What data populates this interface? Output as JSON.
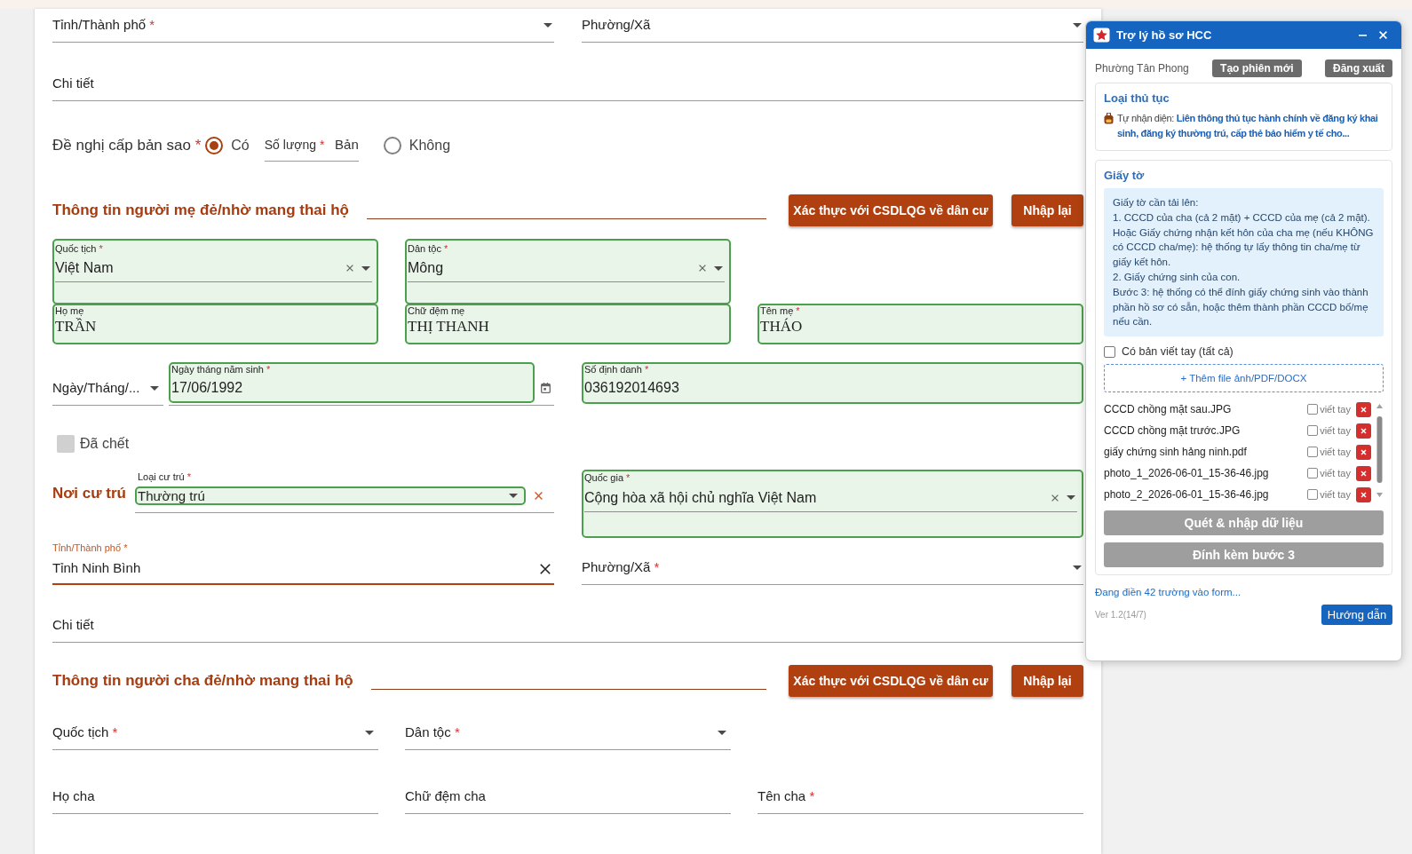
{
  "address_top": {
    "province": {
      "label": "Tỉnh/Thành phố",
      "required_mark": "*"
    },
    "ward": {
      "label": "Phường/Xã"
    },
    "detail": {
      "label": "Chi tiết"
    }
  },
  "copy_request": {
    "label": "Đề nghị cấp bản sao",
    "required_mark": "*",
    "options": [
      {
        "label": "Có",
        "selected": true
      },
      {
        "label": "Không",
        "selected": false
      }
    ],
    "quantity": {
      "label": "Số lượng",
      "required_mark": "*",
      "unit": "Bản"
    }
  },
  "mother": {
    "title": "Thông tin người mẹ đẻ/nhờ mang thai hộ",
    "buttons": [
      "Xác thực với CSDLQG về dân cư",
      "Nhập lại"
    ],
    "nationality": {
      "label": "Quốc tịch",
      "required_mark": "*",
      "value": "Việt Nam",
      "filled": true
    },
    "ethnicity": {
      "label": "Dân tộc",
      "required_mark": "*",
      "value": "Mông",
      "filled": true
    },
    "last_name": {
      "label": "Họ mẹ",
      "value": "TRẦN",
      "filled": true
    },
    "middle_name": {
      "label": "Chữ đệm mẹ",
      "value": "THỊ THANH",
      "filled": true
    },
    "first_name": {
      "label": "Tên mẹ",
      "required_mark": "*",
      "value": "THÁO",
      "filled": true
    },
    "date_format": {
      "value": "Ngày/Tháng/..."
    },
    "birth_date": {
      "label": "Ngày tháng năm sinh",
      "required_mark": "*",
      "value": "17/06/1992",
      "filled": true
    },
    "id_number": {
      "label": "Số định danh",
      "required_mark": "*",
      "value": "036192014693",
      "filled": true
    },
    "deceased": {
      "label": "Đã chết",
      "checked": false,
      "disabled": true
    },
    "residence": {
      "title": "Nơi cư trú",
      "type": {
        "label": "Loại cư trú",
        "required_mark": "*",
        "value": "Thường trú",
        "filled": true
      },
      "country": {
        "label": "Quốc gia",
        "required_mark": "*",
        "value": "Cộng hòa xã hội chủ nghĩa Việt Nam",
        "filled": true
      },
      "province": {
        "label": "Tỉnh/Thành phố",
        "required_mark": "*",
        "value": "Tỉnh Ninh Bình",
        "filled": false,
        "focused": true
      },
      "ward": {
        "label": "Phường/Xã",
        "required_mark": "*",
        "filled": false
      },
      "detail": {
        "label": "Chi tiết"
      }
    }
  },
  "father": {
    "title": "Thông tin người cha đẻ/nhờ mang thai hộ",
    "buttons": [
      "Xác thực với CSDLQG về dân cư",
      "Nhập lại"
    ],
    "nationality": {
      "label": "Quốc tịch",
      "required_mark": "*",
      "filled": false
    },
    "ethnicity": {
      "label": "Dân tộc",
      "required_mark": "*",
      "filled": false
    },
    "last_name": {
      "label": "Họ cha",
      "filled": false
    },
    "middle_name": {
      "label": "Chữ đệm cha",
      "filled": false
    },
    "first_name": {
      "label": "Tên cha",
      "required_mark": "*",
      "filled": false
    }
  },
  "assistant": {
    "title": "Trợ lý hồ sơ HCC",
    "unit": "Phường Tân Phong",
    "header_buttons": [
      "Tạo phiên mới",
      "Đăng xuất"
    ],
    "procedure": {
      "title": "Loại thủ tục",
      "text": "Tự nhận diện: **Liên thông thủ tục hành chính về đăng ký khai sinh, đăng ký thường trú, cấp thẻ bảo hiểm y tế cho...**"
    },
    "documents": {
      "title": "Giấy tờ",
      "instructions": [
        "Giấy tờ cần tải lên:",
        "1. CCCD của cha (cả 2 mặt) + CCCD của mẹ (cả 2 mặt).",
        "Hoặc Giấy chứng nhận kết hôn của cha mẹ (nếu KHÔNG có CCCD cha/mẹ): hệ thống tự lấy thông tin cha/mẹ từ giấy kết hôn.",
        "2. Giấy chứng sinh của con.",
        "Bước 3: hệ thống có thể đính giấy chứng sinh vào thành phần hồ sơ có sẵn, hoặc thêm thành phần CCCD bố/mẹ nếu cần."
      ],
      "handwritten_all": {
        "label": "Có bản viết tay (tất cả)",
        "checked": false
      },
      "add_button": "+ Thêm file ảnh/PDF/DOCX",
      "files": [
        {
          "name": "CCCD chồng mặt sau.JPG",
          "handwritten_label": "viết tay",
          "handwritten": false
        },
        {
          "name": "CCCD chồng mặt trước.JPG",
          "handwritten_label": "viết tay",
          "handwritten": false
        },
        {
          "name": "giấy chứng sinh hảng ninh.pdf",
          "handwritten_label": "viết tay",
          "handwritten": false
        },
        {
          "name": "photo_1_2026-06-01_15-36-46.jpg",
          "handwritten_label": "viết tay",
          "handwritten": false
        },
        {
          "name": "photo_2_2026-06-01_15-36-46.jpg",
          "handwritten_label": "viết tay",
          "handwritten": false
        }
      ],
      "actions": [
        {
          "label": "Quét & nhập dữ liệu",
          "disabled": true
        },
        {
          "label": "Đính kèm bước 3",
          "disabled": true
        }
      ]
    },
    "status": "Đang điền 42 trường vào form...",
    "version": "Ver 1.2(14/7)",
    "help_button": "Hướng dẫn"
  }
}
